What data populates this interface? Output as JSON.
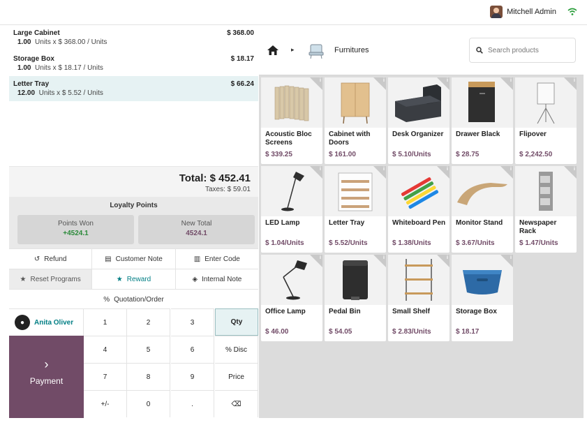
{
  "topbar": {
    "user_name": "Mitchell Admin"
  },
  "order": {
    "lines": [
      {
        "name": "Large Cabinet",
        "qty": "1.00",
        "detail": "Units x $ 368.00 / Units",
        "price": "$ 368.00",
        "selected": false
      },
      {
        "name": "Storage Box",
        "qty": "1.00",
        "detail": "Units x $ 18.17 / Units",
        "price": "$ 18.17",
        "selected": false
      },
      {
        "name": "Letter Tray",
        "qty": "12.00",
        "detail": "Units x $ 5.52 / Units",
        "price": "$ 66.24",
        "selected": true
      }
    ],
    "total": "Total: $ 452.41",
    "taxes": "Taxes: $ 59.01"
  },
  "loyalty": {
    "title": "Loyalty Points",
    "won_label": "Points Won",
    "won_value": "+4524.1",
    "new_total_label": "New Total",
    "new_total_value": "4524.1"
  },
  "controls": {
    "refund": "Refund",
    "customer_note": "Customer Note",
    "enter_code": "Enter Code",
    "reset_programs": "Reset Programs",
    "reward": "Reward",
    "internal_note": "Internal Note",
    "quotation": "Quotation/Order"
  },
  "numpad": {
    "customer": "Anita Oliver",
    "payment": "Payment",
    "keys": [
      "1",
      "2",
      "3",
      "Qty",
      "4",
      "5",
      "6",
      "% Disc",
      "7",
      "8",
      "9",
      "Price",
      "+/-",
      "0",
      ".",
      "⌫"
    ]
  },
  "category": {
    "name": "Furnitures"
  },
  "search": {
    "placeholder": "Search products"
  },
  "products": [
    {
      "name": "Acoustic Bloc Screens",
      "price": "$ 339.25",
      "icon": "acoustic-screen"
    },
    {
      "name": "Cabinet with Doors",
      "price": "$ 161.00",
      "icon": "cabinet"
    },
    {
      "name": "Desk Organizer",
      "price": "$ 5.10/Units",
      "icon": "desk-organizer"
    },
    {
      "name": "Drawer Black",
      "price": "$ 28.75",
      "icon": "drawer"
    },
    {
      "name": "Flipover",
      "price": "$ 2,242.50",
      "icon": "flipover"
    },
    {
      "name": "LED Lamp",
      "price": "$ 1.04/Units",
      "icon": "led-lamp"
    },
    {
      "name": "Letter Tray",
      "price": "$ 5.52/Units",
      "icon": "letter-tray"
    },
    {
      "name": "Whiteboard Pen",
      "price": "$ 1.38/Units",
      "icon": "whiteboard-pen"
    },
    {
      "name": "Monitor Stand",
      "price": "$ 3.67/Units",
      "icon": "monitor-stand"
    },
    {
      "name": "Newspaper Rack",
      "price": "$ 1.47/Units",
      "icon": "newspaper-rack"
    },
    {
      "name": "Office Lamp",
      "price": "$ 46.00",
      "icon": "office-lamp"
    },
    {
      "name": "Pedal Bin",
      "price": "$ 54.05",
      "icon": "pedal-bin"
    },
    {
      "name": "Small Shelf",
      "price": "$ 2.83/Units",
      "icon": "small-shelf"
    },
    {
      "name": "Storage Box",
      "price": "$ 18.17",
      "icon": "storage-box"
    }
  ],
  "colors": {
    "accent": "#714b67",
    "teal": "#017e84",
    "selected_bg": "#e6f2f3"
  }
}
